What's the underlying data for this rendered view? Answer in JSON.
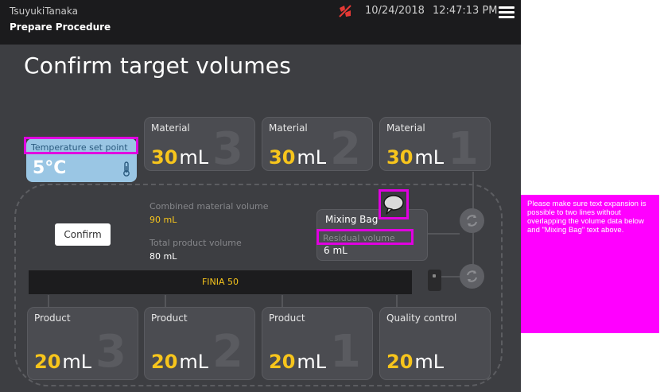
{
  "header": {
    "user": "TsuyukiTanaka",
    "screen": "Prepare Procedure",
    "date": "10/24/2018",
    "time": "12:47:13 PM",
    "alert_icon": "alert-icon",
    "menu_icon": "menu-icon"
  },
  "page": {
    "title": "Confirm target volumes"
  },
  "temperature": {
    "label": "Temperature set point",
    "value": "5°C",
    "icon": "thermometer-icon"
  },
  "materials": [
    {
      "label": "Material",
      "value": "30",
      "unit": "mL",
      "index": "3"
    },
    {
      "label": "Material",
      "value": "30",
      "unit": "mL",
      "index": "2"
    },
    {
      "label": "Material",
      "value": "30",
      "unit": "mL",
      "index": "1"
    }
  ],
  "summary": {
    "combined_label": "Combined material volume",
    "combined_value": "90 mL",
    "total_label": "Total product volume",
    "total_value": "80 mL"
  },
  "confirm_label": "Confirm",
  "mixing_bag": {
    "title": "Mixing Bag",
    "residual_label": "Residual volume",
    "residual_value": "6 mL"
  },
  "device": {
    "label": "FINIA 50"
  },
  "products": [
    {
      "label": "Product",
      "value": "20",
      "unit": "mL",
      "index": "3"
    },
    {
      "label": "Product",
      "value": "20",
      "unit": "mL",
      "index": "2"
    },
    {
      "label": "Product",
      "value": "20",
      "unit": "mL",
      "index": "1"
    },
    {
      "label": "Quality control",
      "value": "20",
      "unit": "mL",
      "index": ""
    }
  ],
  "annotation": {
    "note": "Please make sure text expansion is possible to two lines without overlapping the volume data below and \"Mixing Bag\" text above."
  },
  "colors": {
    "accent_yellow": "#f7c51c",
    "annotation_magenta": "#ff00ff",
    "temp_blue": "#9ac6e4",
    "background": "#3d3e42"
  }
}
